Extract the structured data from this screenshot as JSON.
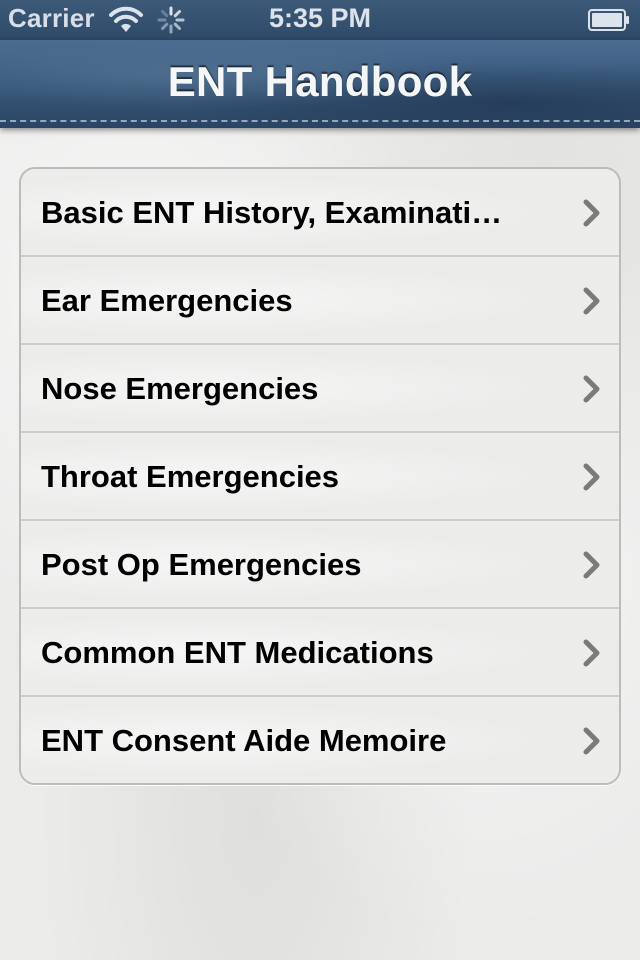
{
  "status_bar": {
    "carrier": "Carrier",
    "time": "5:35 PM",
    "icons": [
      "wifi-icon",
      "activity-spinner-icon",
      "battery-icon"
    ]
  },
  "nav_bar": {
    "title": "ENT Handbook"
  },
  "menu": {
    "items": [
      {
        "label": "Basic ENT History, Examinati…",
        "icon": "chevron-right-icon"
      },
      {
        "label": "Ear Emergencies",
        "icon": "chevron-right-icon"
      },
      {
        "label": "Nose Emergencies",
        "icon": "chevron-right-icon"
      },
      {
        "label": "Throat Emergencies",
        "icon": "chevron-right-icon"
      },
      {
        "label": "Post Op Emergencies",
        "icon": "chevron-right-icon"
      },
      {
        "label": "Common ENT Medications",
        "icon": "chevron-right-icon"
      },
      {
        "label": "ENT Consent Aide Memoire",
        "icon": "chevron-right-icon"
      }
    ]
  },
  "colors": {
    "nav_bar": "#3a5a7d",
    "status_bar": "#2e4a69",
    "background": "#ebebea",
    "row_text": "#000000",
    "chevron": "#7a7a7a"
  }
}
